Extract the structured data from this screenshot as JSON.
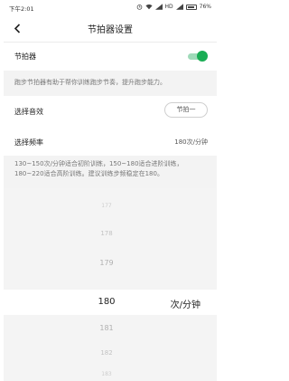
{
  "status_bar": {
    "time": "下午2:01",
    "network": "HD",
    "battery": "76%"
  },
  "nav": {
    "title": "节拍器设置"
  },
  "metronome": {
    "label": "节拍器",
    "enabled": true,
    "description": "跑步节拍器有助于帮你训练跑步节奏，提升跑步能力。"
  },
  "sound": {
    "label": "选择音效",
    "selected": "节拍一"
  },
  "frequency": {
    "label": "选择频率",
    "value": "180次/分钟",
    "description": "130~150次/分钟适合初阶训练，150~180适合进阶训练，180~220适合高阶训练。建议训练步频稳定在180。"
  },
  "picker": {
    "above": [
      "177",
      "178",
      "179"
    ],
    "selected": "180",
    "unit": "次/分钟",
    "below": [
      "181",
      "182",
      "183"
    ]
  },
  "colors": {
    "accent": "#1aad55",
    "description_bg": "#f3f3f3"
  }
}
